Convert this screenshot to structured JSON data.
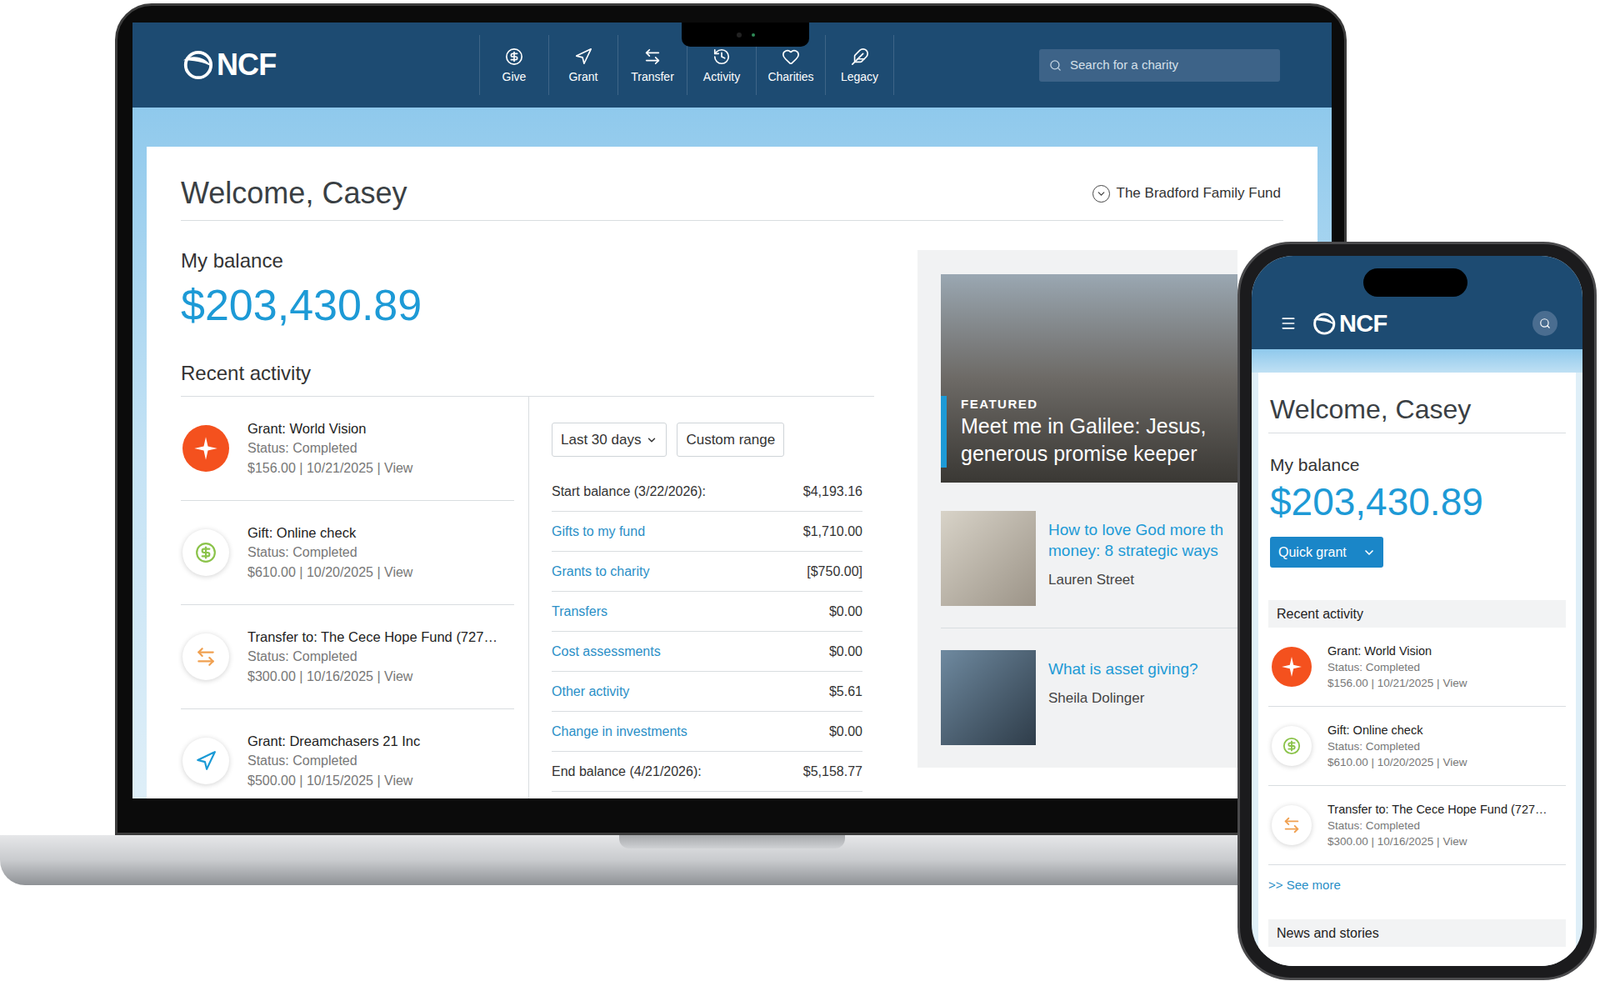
{
  "laptop": {
    "logo": "NCF",
    "nav": [
      {
        "label": "Give"
      },
      {
        "label": "Grant"
      },
      {
        "label": "Transfer"
      },
      {
        "label": "Activity"
      },
      {
        "label": "Charities"
      },
      {
        "label": "Legacy"
      }
    ],
    "search": {
      "placeholder": "Search for a charity"
    },
    "welcome": "Welcome, Casey",
    "fund": "The Bradford Family Fund",
    "balance_label": "My balance",
    "balance": "$203,430.89",
    "recent_activity_title": "Recent activity",
    "activity": [
      {
        "kind": "charity-logo",
        "title": "Grant: World Vision",
        "status": "Status: Completed",
        "meta": "$156.00 | 10/21/2025 | View"
      },
      {
        "kind": "gift",
        "title": "Gift: Online check",
        "status": "Status: Completed",
        "meta": "$610.00 | 10/20/2025 | View"
      },
      {
        "kind": "transfer",
        "title": "Transfer to: The Cece Hope Fund (727…",
        "status": "Status: Completed",
        "meta": "$300.00 | 10/16/2025 | View"
      },
      {
        "kind": "grant",
        "title": "Grant: Dreamchasers 21 Inc",
        "status": "Status: Completed",
        "meta": "$500.00 | 10/15/2025 | View"
      }
    ],
    "filters": [
      {
        "label": "Last 30 days",
        "dropdown": true
      },
      {
        "label": "Custom range",
        "dropdown": false
      }
    ],
    "summary": [
      {
        "label": "Start balance (3/22/2026):",
        "value": "$4,193.16",
        "link": false
      },
      {
        "label": "Gifts to my fund",
        "value": "$1,710.00",
        "link": true
      },
      {
        "label": "Grants to charity",
        "value": "[$750.00]",
        "link": true
      },
      {
        "label": "Transfers",
        "value": "$0.00",
        "link": true
      },
      {
        "label": "Cost assessments",
        "value": "$0.00",
        "link": true
      },
      {
        "label": "Other activity",
        "value": "$5.61",
        "link": true
      },
      {
        "label": "Change in investments",
        "value": "$0.00",
        "link": true
      },
      {
        "label": "End balance (4/21/2026):",
        "value": "$5,158.77",
        "link": false
      }
    ],
    "featured": {
      "tag": "FEATURED",
      "title_lines": [
        "Meet me in Galilee: Jesus,",
        "generous promise keeper"
      ]
    },
    "articles": [
      {
        "title_lines": [
          "How to love God more th",
          "money: 8 strategic ways"
        ],
        "author": "Lauren Street"
      },
      {
        "title_lines": [
          "What is asset giving?"
        ],
        "author": "Sheila Dolinger"
      }
    ]
  },
  "phone": {
    "logo": "NCF",
    "welcome": "Welcome, Casey",
    "balance_label": "My balance",
    "balance": "$203,430.89",
    "quick_grant": "Quick grant",
    "recent_activity_title": "Recent activity",
    "activity": [
      {
        "kind": "charity-logo",
        "title": "Grant: World Vision",
        "status": "Status: Completed",
        "meta": "$156.00 | 10/21/2025 | View"
      },
      {
        "kind": "gift",
        "title": "Gift: Online check",
        "status": "Status: Completed",
        "meta": "$610.00 | 10/20/2025 | View"
      },
      {
        "kind": "transfer",
        "title": "Transfer to: The Cece Hope Fund (727…",
        "status": "Status: Completed",
        "meta": "$300.00 | 10/16/2025 | View"
      }
    ],
    "see_more": ">> See more",
    "news_title": "News and stories"
  }
}
